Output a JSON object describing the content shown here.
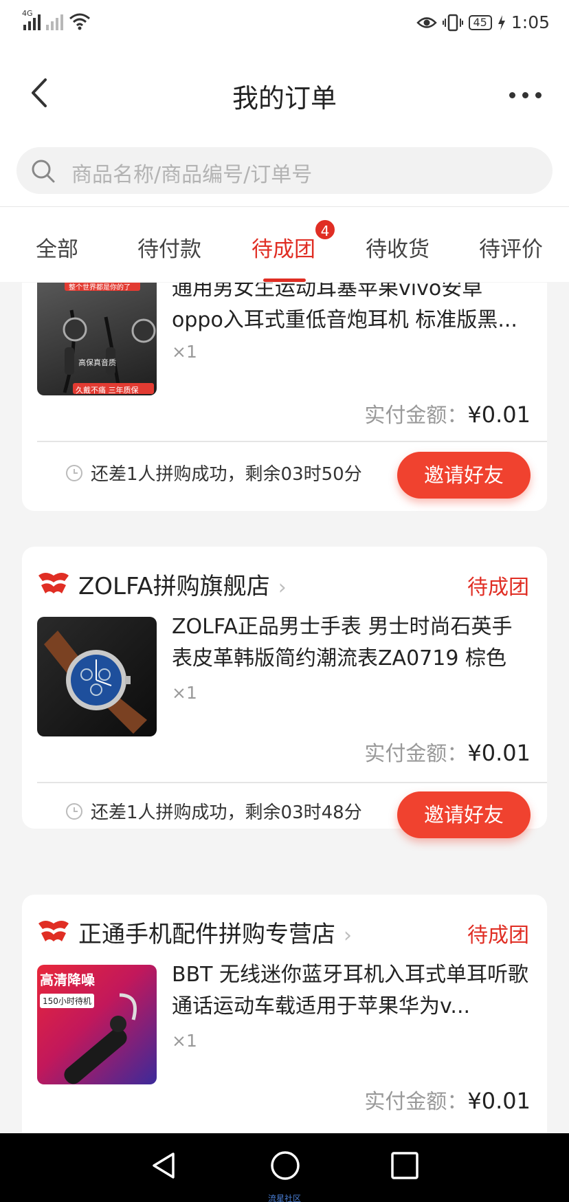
{
  "status_bar": {
    "network_tag": "4G",
    "battery": "45",
    "time": "1:05"
  },
  "header": {
    "title": "我的订单"
  },
  "search": {
    "placeholder": "商品名称/商品编号/订单号"
  },
  "tabs": [
    {
      "label": "全部"
    },
    {
      "label": "待付款"
    },
    {
      "label": "待成团",
      "badge": "4",
      "active": true
    },
    {
      "label": "待收货"
    },
    {
      "label": "待评价"
    }
  ],
  "orders": [
    {
      "title": "通用男女生运动耳塞苹果vivo安卓oppo入耳式重低音炮耳机 标准版黑...",
      "qty": "×1",
      "paid_label": "实付金额：",
      "paid_amount": "¥0.01",
      "countdown": "还差1人拼购成功，剩余03时50分",
      "action": "邀请好友",
      "thumb_top_text": "整个世界都是你的了",
      "thumb_mid_text": "高保真音质",
      "thumb_bottom_text": "久戴不痛 三年质保"
    },
    {
      "store": "ZOLFA拼购旗舰店",
      "status": "待成团",
      "title": "ZOLFA正品男士手表 男士时尚石英手表皮革韩版简约潮流表ZA0719 棕色",
      "qty": "×1",
      "paid_label": "实付金额：",
      "paid_amount": "¥0.01",
      "countdown": "还差1人拼购成功，剩余03时48分",
      "action": "邀请好友"
    },
    {
      "store": "正通手机配件拼购专营店",
      "status": "待成团",
      "title": "BBT 无线迷你蓝牙耳机入耳式单耳听歌通话运动车载适用于苹果华为v...",
      "qty": "×1",
      "paid_label": "实付金额：",
      "paid_amount": "¥0.01",
      "thumb_text_1": "高清降噪",
      "thumb_text_2": "150小时待机"
    }
  ],
  "watermark": "流星社区",
  "colors": {
    "accent": "#e02e24",
    "button": "#f0422f"
  }
}
